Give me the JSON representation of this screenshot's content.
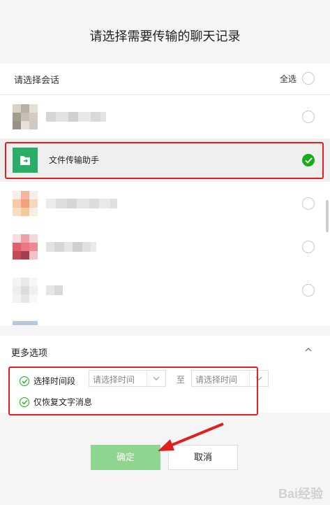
{
  "dialog": {
    "title": "请选择需要传输的聊天记录"
  },
  "list_header": {
    "label": "请选择会话",
    "select_all": "全选"
  },
  "conversations": [
    {
      "name": "",
      "selected": false
    },
    {
      "name": "文件传输助手",
      "selected": true
    },
    {
      "name": "",
      "selected": false
    },
    {
      "name": "",
      "selected": false
    },
    {
      "name": "",
      "selected": false
    }
  ],
  "options": {
    "header": "更多选项",
    "time_range_label": "选择时间段",
    "start_placeholder": "请选择时间",
    "to_label": "至",
    "end_placeholder": "请选择时间",
    "text_only_label": "仅恢复文字消息"
  },
  "buttons": {
    "confirm": "确定",
    "cancel": "取消"
  },
  "watermark": "Bai经验",
  "colors": {
    "accent": "#1aad19",
    "highlight": "#e02020",
    "confirm_bg": "#8fd48f"
  }
}
